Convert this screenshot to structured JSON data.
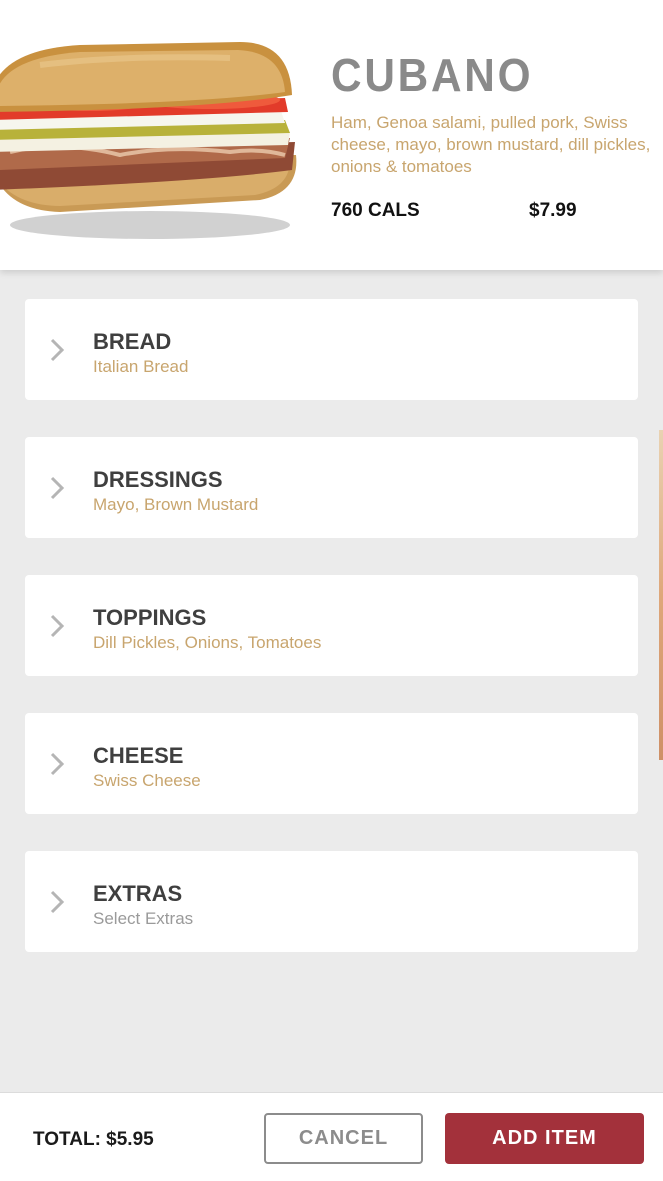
{
  "product": {
    "name": "CUBANO",
    "description": "Ham, Genoa salami, pulled pork, Swiss cheese, mayo, brown mustard, dill pickles, onions & tomatoes",
    "calories": "760 CALS",
    "price": "$7.99"
  },
  "options": [
    {
      "label": "BREAD",
      "value": "Italian Bread"
    },
    {
      "label": "DRESSINGS",
      "value": "Mayo, Brown Mustard"
    },
    {
      "label": "TOPPINGS",
      "value": "Dill Pickles, Onions, Tomatoes"
    },
    {
      "label": "CHEESE",
      "value": "Swiss Cheese"
    },
    {
      "label": "EXTRAS",
      "value": "Select Extras"
    }
  ],
  "footer": {
    "total": "TOTAL: $5.95",
    "cancel_label": "CANCEL",
    "add_label": "ADD ITEM"
  },
  "colors": {
    "accent_tan": "#c8a56e",
    "add_button": "#a3313b",
    "background": "#ebebeb"
  },
  "icons": {
    "option_chevron": "chevron-right-icon",
    "product_image": "sandwich-image"
  }
}
